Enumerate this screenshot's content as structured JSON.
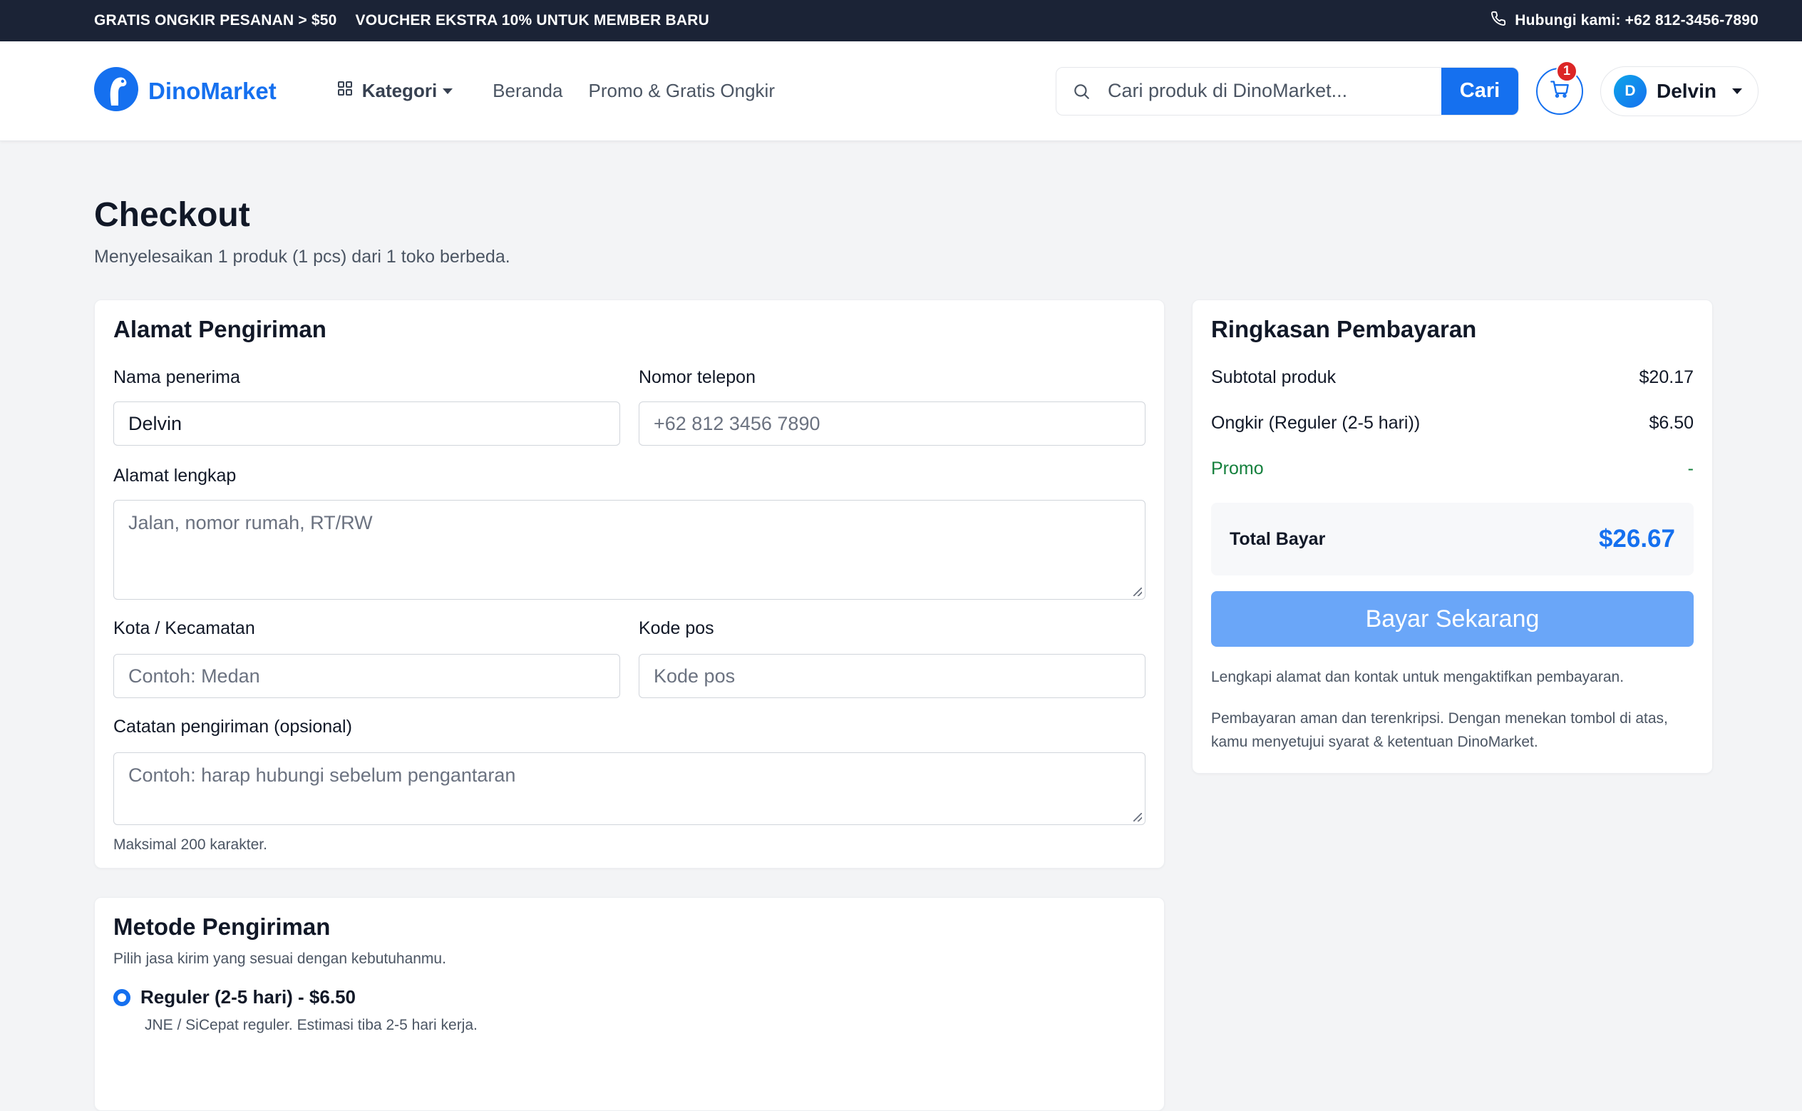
{
  "topbar": {
    "promo_1": "GRATIS ONGKIR PESANAN > $50",
    "promo_2": "VOUCHER EKSTRA 10% UNTUK MEMBER BARU",
    "contact": "Hubungi kami: +62 812-3456-7890"
  },
  "header": {
    "logo": "DinoMarket",
    "nav": {
      "kategori": "Kategori",
      "beranda": "Beranda",
      "promo": "Promo & Gratis Ongkir"
    },
    "search": {
      "placeholder": "Cari produk di DinoMarket...",
      "button": "Cari"
    },
    "cart_count": "1",
    "user": {
      "initial": "D",
      "name": "Delvin"
    }
  },
  "page": {
    "title": "Checkout",
    "subtitle": "Menyelesaikan 1 produk (1 pcs) dari 1 toko berbeda."
  },
  "address": {
    "heading": "Alamat Pengiriman",
    "name_label": "Nama penerima",
    "name_value": "Delvin",
    "phone_label": "Nomor telepon",
    "phone_placeholder": "+62 812 3456 7890",
    "address_label": "Alamat lengkap",
    "address_placeholder": "Jalan, nomor rumah, RT/RW",
    "city_label": "Kota / Kecamatan",
    "city_placeholder": "Contoh: Medan",
    "zip_label": "Kode pos",
    "zip_placeholder": "Kode pos",
    "note_label": "Catatan pengiriman (opsional)",
    "note_placeholder": "Contoh: harap hubungi sebelum pengantaran",
    "note_hint": "Maksimal 200 karakter."
  },
  "shipping": {
    "heading": "Metode Pengiriman",
    "subtitle": "Pilih jasa kirim yang sesuai dengan kebutuhanmu.",
    "option_label": "Reguler (2-5 hari) - $6.50",
    "option_desc": "JNE / SiCepat reguler. Estimasi tiba 2-5 hari kerja."
  },
  "summary": {
    "heading": "Ringkasan Pembayaran",
    "subtotal_label": "Subtotal produk",
    "subtotal_value": "$20.17",
    "shipping_label": "Ongkir (Reguler (2-5 hari))",
    "shipping_value": "$6.50",
    "promo_label": "Promo",
    "promo_value": "-",
    "total_label": "Total Bayar",
    "total_value": "$26.67",
    "pay_button": "Bayar Sekarang",
    "note_1": "Lengkapi alamat dan kontak untuk mengaktifkan pembayaran.",
    "note_2": "Pembayaran aman dan terenkripsi. Dengan menekan tombol di atas, kamu menyetujui syarat & ketentuan DinoMarket."
  },
  "colors": {
    "brand": "#1570ef",
    "topbar": "#1b2336",
    "pay_button_disabled": "#6aa6f8",
    "promo": "#15803d",
    "badge": "#dc2626"
  }
}
